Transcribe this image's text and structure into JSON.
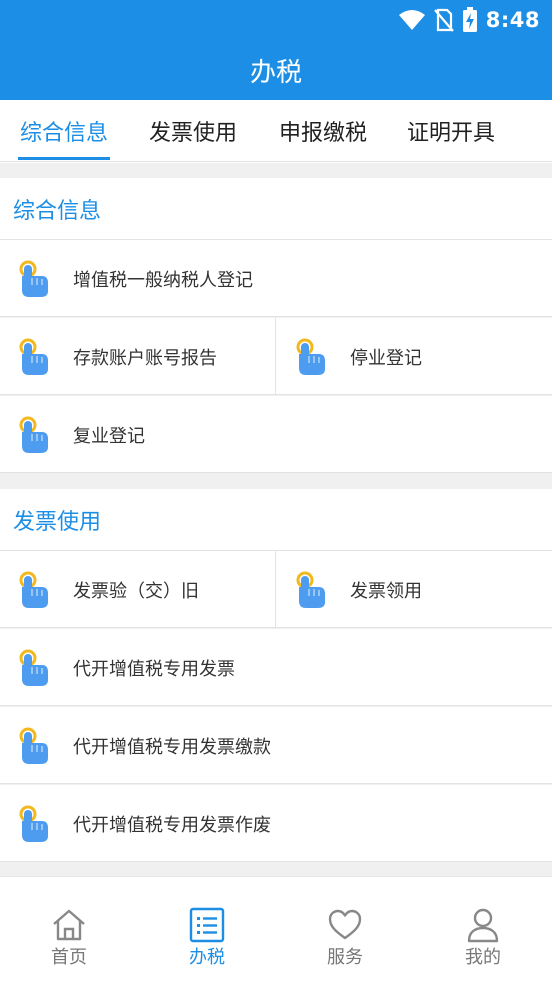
{
  "status_bar": {
    "time": "8:48",
    "icons": [
      "wifi-icon",
      "no-sim-icon",
      "battery-charging-icon"
    ]
  },
  "header": {
    "title": "办税"
  },
  "tabs": [
    {
      "label": "综合信息",
      "active": true
    },
    {
      "label": "发票使用",
      "active": false
    },
    {
      "label": "申报缴税",
      "active": false
    },
    {
      "label": "证明开具",
      "active": false
    }
  ],
  "sections": [
    {
      "title": "综合信息",
      "items": [
        "增值税一般纳税人登记",
        "存款账户账号报告",
        "停业登记",
        "复业登记"
      ]
    },
    {
      "title": "发票使用",
      "items": [
        "发票验（交）旧",
        "发票领用",
        "代开增值税专用发票",
        "代开增值税专用发票缴款",
        "代开增值税专用发票作废"
      ]
    }
  ],
  "bottom_nav": [
    {
      "label": "首页",
      "icon": "home-icon",
      "active": false
    },
    {
      "label": "办税",
      "icon": "list-icon",
      "active": true
    },
    {
      "label": "服务",
      "icon": "heart-icon",
      "active": false
    },
    {
      "label": "我的",
      "icon": "person-icon",
      "active": false
    }
  ],
  "colors": {
    "primary": "#1c8ee6",
    "text": "#333333",
    "divider": "#e3e3e3",
    "background": "#f0f0f0"
  }
}
